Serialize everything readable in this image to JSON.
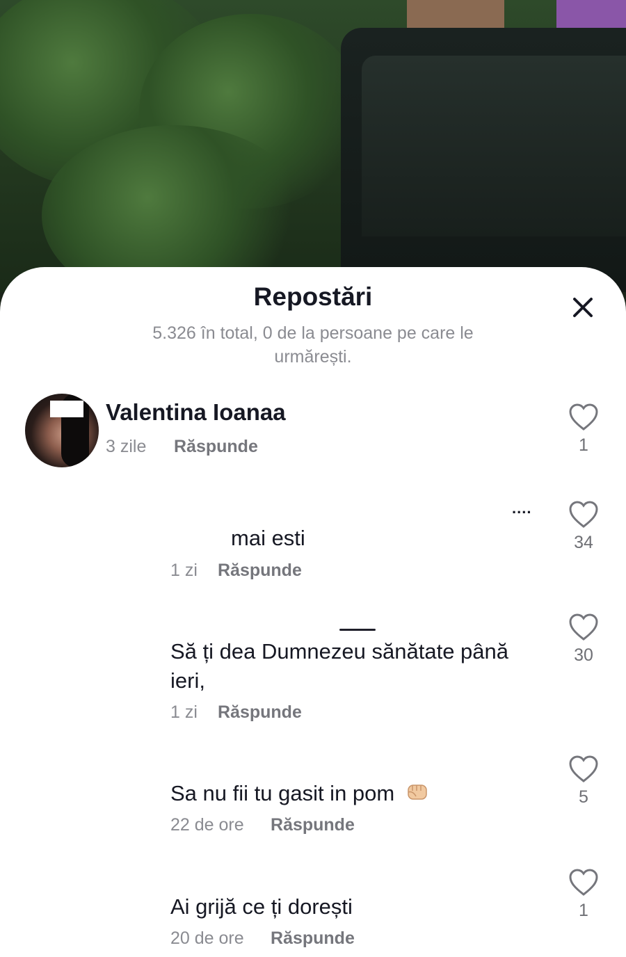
{
  "sheet": {
    "title": "Repostări",
    "subtitle": "5.326 în total, 0 de la persoane pe care le urmărești."
  },
  "comments": [
    {
      "username": "Valentina Ioanaa",
      "time": "3 zile",
      "reply": "Răspunde",
      "likes": "1"
    },
    {
      "text": "mai esti",
      "time": "1 zi",
      "reply": "Răspunde",
      "likes": "34",
      "more": "...."
    },
    {
      "text": "Să ți dea Dumnezeu sănătate până ieri,",
      "time": "1 zi",
      "reply": "Răspunde",
      "likes": "30"
    },
    {
      "text": "Sa nu fii tu gasit in pom",
      "emoji": "fist-emoji-icon",
      "time": "22 de ore",
      "reply": "Răspunde",
      "likes": "5"
    },
    {
      "text": "Ai grijă ce ți dorești",
      "time": "20 de ore",
      "reply": "Răspunde",
      "likes": "1"
    }
  ],
  "colors": {
    "text_primary": "#161823",
    "text_secondary": "#8a8b91",
    "sheet_bg": "#ffffff"
  }
}
